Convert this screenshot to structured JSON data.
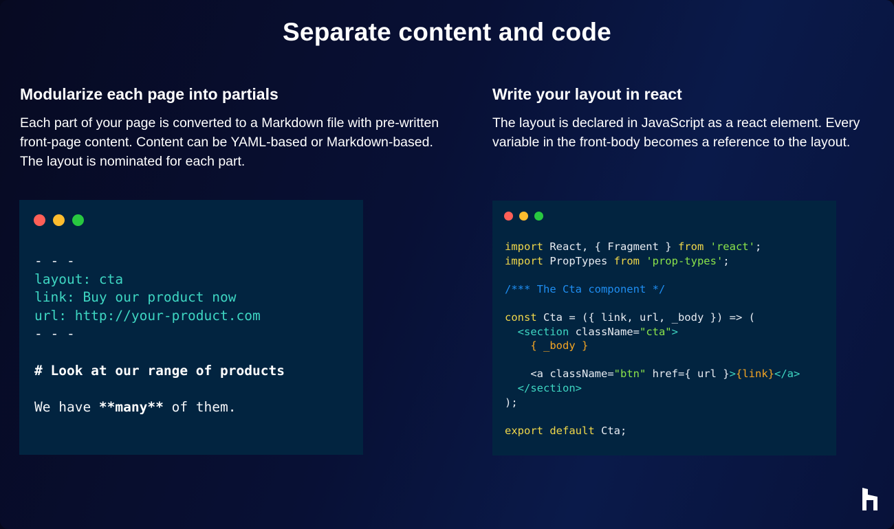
{
  "title": "Separate content and code",
  "left": {
    "heading": "Modularize each page into partials",
    "body": "Each part of your page is converted to a Markdown file with pre-written front-page content. Content can be YAML-based or Markdown-based. The layout is nominated for each part.",
    "code": {
      "fence_open": "- - -",
      "layout": "layout: cta",
      "link": "link: Buy our product now",
      "url": "url: http://your-product.com",
      "fence_close": "- - -",
      "heading": "# Look at our range of products",
      "text_before": "We have ",
      "text_bold": "**many**",
      "text_after": " of them."
    }
  },
  "right": {
    "heading": "Write your layout in react",
    "body": "The layout is declared in JavaScript as a react element. Every variable in the front-body becomes a reference to the layout.",
    "code": {
      "import_kw": "import",
      "import1_names": " React, { Fragment } ",
      "from_kw": "from",
      "import1_src": " 'react'",
      "semi": ";",
      "import2_names": " PropTypes ",
      "import2_src": " 'prop-types'",
      "comment": "/*** The Cta component */",
      "const_kw": "const",
      "const_rest": " Cta = ({ link, url, _body }) => (",
      "section_open_tag": "  <section",
      "section_attr": " className=",
      "section_attr_val": "\"cta\"",
      "tag_close": ">",
      "body_expr": "    { _body }",
      "a_open": "    <a",
      "a_class_attr": " className=",
      "a_class_val": "\"btn\"",
      "a_href": " href={ url }",
      "a_link": "{link}",
      "a_close": "</a>",
      "section_close": "  </section>",
      "paren_close": ");",
      "export_kw": "export default",
      "export_rest": " Cta;"
    }
  },
  "colors": {
    "background": "#081035",
    "code_bg": "#022440",
    "teal": "#3ed6c2",
    "keyword": "#f0d74a",
    "string": "#8be34a",
    "comment": "#1f8ef2",
    "accent_orange": "#f5a623"
  },
  "icons": [
    "brand-logo-icon"
  ]
}
